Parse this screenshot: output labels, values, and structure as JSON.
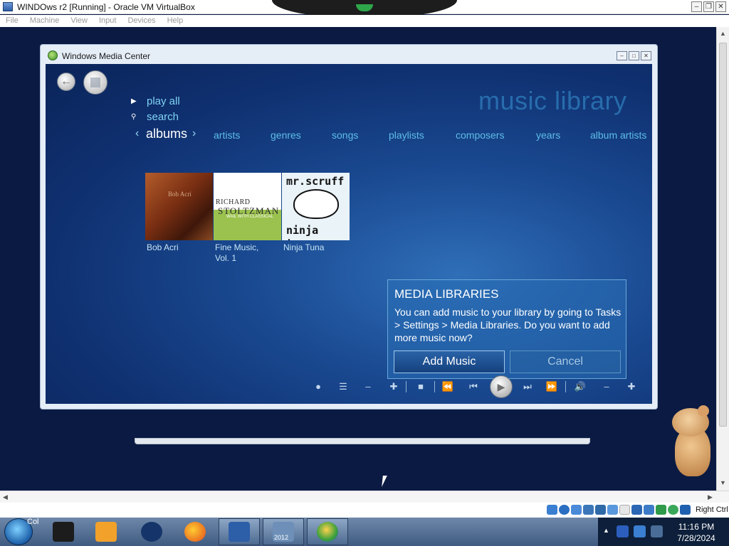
{
  "virtualbox": {
    "title": "WINDOws r2 [Running] - Oracle VM VirtualBox",
    "menu": [
      "File",
      "Machine",
      "View",
      "Input",
      "Devices",
      "Help"
    ],
    "host_key": "Right Ctrl"
  },
  "media_center": {
    "window_title": "Windows Media Center",
    "commands": [
      {
        "icon": "play-icon",
        "label": "play all"
      },
      {
        "icon": "search-icon",
        "label": "search"
      }
    ],
    "page_title": "music library",
    "tabs": {
      "active": "albums",
      "items": [
        "artists",
        "genres",
        "songs",
        "playlists",
        "composers",
        "years",
        "album artists"
      ]
    },
    "albums": [
      {
        "title": "Bob Acri",
        "cover_text": "Bob Acri"
      },
      {
        "title": "Fine Music, Vol. 1",
        "title_line1": "Fine Music,",
        "title_line2": "Vol. 1",
        "cover_text_1": "RICHARD",
        "cover_text_2": "STOLTZMAN",
        "cover_sub": "WAIL WITH CLASSICAL"
      },
      {
        "title": "Ninja Tuna",
        "cover_text_top": "mr.scruff",
        "cover_text_bottom": "ninja tuna"
      }
    ],
    "dialog": {
      "title": "MEDIA LIBRARIES",
      "body": "You can add music to your library by going to Tasks > Settings > Media Libraries. Do you want to add more music now?",
      "primary_button": "Add Music",
      "secondary_button": "Cancel"
    },
    "transport": [
      "record",
      "guide",
      "channel-down",
      "channel-up",
      "stop",
      "rewind",
      "previous",
      "play",
      "next",
      "fast-forward",
      "mute",
      "volume-down",
      "volume-up"
    ]
  },
  "taskbar": {
    "start_label": "Col",
    "pinned": [
      "terminal",
      "media-player",
      "globe",
      "firefox",
      "virtualbox",
      "server-2012",
      "windows-vm"
    ],
    "pinned_badge": "2012",
    "clock_time": "11:16 PM",
    "clock_date": "7/28/2024"
  },
  "colors": {
    "wmc_accent": "#7fd3f4",
    "wmc_background": "#1a4a92",
    "taskbar": "#4d6a90"
  }
}
